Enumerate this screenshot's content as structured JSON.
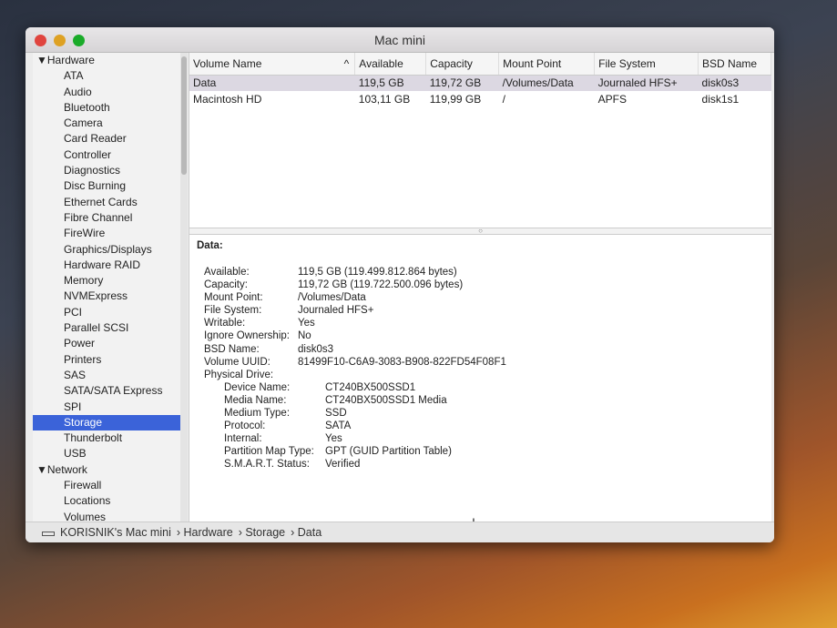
{
  "window": {
    "title": "Mac mini"
  },
  "sidebar": {
    "items": [
      {
        "label": "▼Hardware",
        "group": true
      },
      {
        "label": "ATA"
      },
      {
        "label": "Audio"
      },
      {
        "label": "Bluetooth"
      },
      {
        "label": "Camera"
      },
      {
        "label": "Card Reader"
      },
      {
        "label": "Controller"
      },
      {
        "label": "Diagnostics"
      },
      {
        "label": "Disc Burning"
      },
      {
        "label": "Ethernet Cards"
      },
      {
        "label": "Fibre Channel"
      },
      {
        "label": "FireWire"
      },
      {
        "label": "Graphics/Displays"
      },
      {
        "label": "Hardware RAID"
      },
      {
        "label": "Memory"
      },
      {
        "label": "NVMExpress"
      },
      {
        "label": "PCI"
      },
      {
        "label": "Parallel SCSI"
      },
      {
        "label": "Power"
      },
      {
        "label": "Printers"
      },
      {
        "label": "SAS"
      },
      {
        "label": "SATA/SATA Express"
      },
      {
        "label": "SPI"
      },
      {
        "label": "Storage",
        "selected": true
      },
      {
        "label": "Thunderbolt"
      },
      {
        "label": "USB"
      },
      {
        "label": "▼Network",
        "group": true
      },
      {
        "label": "Firewall"
      },
      {
        "label": "Locations"
      },
      {
        "label": "Volumes"
      }
    ]
  },
  "table": {
    "columns": [
      "Volume Name",
      "Available",
      "Capacity",
      "Mount Point",
      "File System",
      "BSD Name"
    ],
    "sort_indicator": "^",
    "rows": [
      [
        "Data",
        "119,5 GB",
        "119,72 GB",
        "/Volumes/Data",
        "Journaled HFS+",
        "disk0s3"
      ],
      [
        "Macintosh HD",
        "103,11 GB",
        "119,99 GB",
        "/",
        "APFS",
        "disk1s1"
      ]
    ]
  },
  "detail": {
    "heading": "Data:",
    "fields": [
      {
        "k": "Available:",
        "v": "119,5 GB (119.499.812.864 bytes)"
      },
      {
        "k": "Capacity:",
        "v": "119,72 GB (119.722.500.096 bytes)"
      },
      {
        "k": "Mount Point:",
        "v": "/Volumes/Data"
      },
      {
        "k": "File System:",
        "v": "Journaled HFS+"
      },
      {
        "k": "Writable:",
        "v": "Yes"
      },
      {
        "k": "Ignore Ownership:",
        "v": "No"
      },
      {
        "k": "BSD Name:",
        "v": "disk0s3"
      },
      {
        "k": "Volume UUID:",
        "v": "81499F10-C6A9-3083-B908-822FD54F08F1"
      },
      {
        "k": "Physical Drive:",
        "v": ""
      },
      {
        "k": "Device Name:",
        "v": "CT240BX500SSD1",
        "sub": true
      },
      {
        "k": "Media Name:",
        "v": "CT240BX500SSD1 Media",
        "sub": true
      },
      {
        "k": "Medium Type:",
        "v": "SSD",
        "sub": true
      },
      {
        "k": "Protocol:",
        "v": "SATA",
        "sub": true
      },
      {
        "k": "Internal:",
        "v": "Yes",
        "sub": true
      },
      {
        "k": "Partition Map Type:",
        "v": "GPT (GUID Partition Table)",
        "sub": true
      },
      {
        "k": "S.M.A.R.T. Status:",
        "v": "Verified",
        "sub": true
      }
    ]
  },
  "pathbar": [
    "KORISNIK's Mac mini",
    "› Hardware",
    "› Storage",
    "› Data"
  ]
}
